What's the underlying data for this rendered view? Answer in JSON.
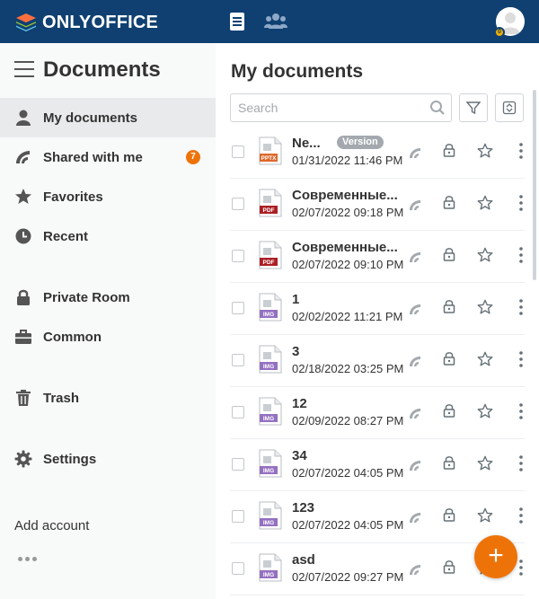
{
  "colors": {
    "header_bg": "#0f4071",
    "accent": "#ed7309",
    "active_item_bg": "#e9eaeb",
    "sidebar_bg": "#f8f9f9"
  },
  "header": {
    "logo_text": "ONLYOFFICE",
    "icons": [
      "documents-icon",
      "people-icon"
    ],
    "avatar_badge": "0"
  },
  "sidebar": {
    "title": "Documents",
    "items": [
      {
        "label": "My documents",
        "icon": "person-icon",
        "active": true
      },
      {
        "label": "Shared with me",
        "icon": "share-icon",
        "badge": "7"
      },
      {
        "label": "Favorites",
        "icon": "star-icon"
      },
      {
        "label": "Recent",
        "icon": "clock-icon"
      },
      {
        "label": "Private Room",
        "icon": "lock-icon"
      },
      {
        "label": "Common",
        "icon": "briefcase-icon"
      },
      {
        "label": "Trash",
        "icon": "trash-icon"
      },
      {
        "label": "Settings",
        "icon": "gear-icon"
      }
    ],
    "add_account": "Add account"
  },
  "main": {
    "title": "My documents",
    "search_placeholder": "Search",
    "version_badge": "Version",
    "files": [
      {
        "name": "Ne...",
        "date": "01/31/2022 11:46 PM",
        "type": "PPTX"
      },
      {
        "name": "Современные...",
        "date": "02/07/2022 09:18 PM",
        "type": "PDF"
      },
      {
        "name": "Современные...",
        "date": "02/07/2022 09:10 PM",
        "type": "PDF"
      },
      {
        "name": "1",
        "date": "02/02/2022 11:21 PM",
        "type": "IMG"
      },
      {
        "name": "3",
        "date": "02/18/2022 03:25 PM",
        "type": "IMG"
      },
      {
        "name": "12",
        "date": "02/09/2022 08:27 PM",
        "type": "IMG"
      },
      {
        "name": "34",
        "date": "02/07/2022 04:05 PM",
        "type": "IMG"
      },
      {
        "name": "123",
        "date": "02/07/2022 04:05 PM",
        "type": "IMG"
      },
      {
        "name": "asd",
        "date": "02/07/2022 09:27 PM",
        "type": "IMG"
      }
    ]
  },
  "fab_label": "+"
}
